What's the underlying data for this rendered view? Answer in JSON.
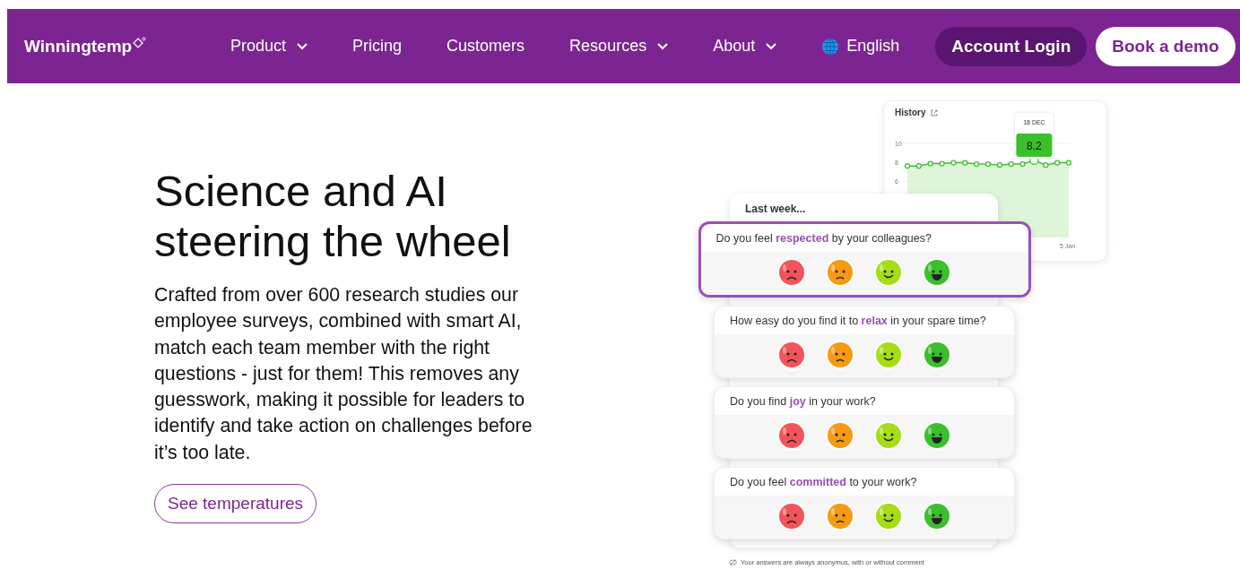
{
  "nav": {
    "logo": "Winningtemp",
    "items": [
      {
        "label": "Product",
        "dropdown": true
      },
      {
        "label": "Pricing",
        "dropdown": false
      },
      {
        "label": "Customers",
        "dropdown": false
      },
      {
        "label": "Resources",
        "dropdown": true
      },
      {
        "label": "About",
        "dropdown": true
      }
    ],
    "language": "English",
    "login": "Account Login",
    "demo": "Book a demo"
  },
  "hero": {
    "title": "Science and AI steering the wheel",
    "body": "Crafted from over 600 research studies our employee surveys, combined with smart AI, match each team member with the right questions - just for them! This removes any guesswork, making it possible for leaders to identify and take action on challenges before it’s too late.",
    "cta": "See temperatures"
  },
  "history": {
    "title": "History",
    "y_labels": [
      "10",
      "8",
      "6"
    ],
    "tooltip": {
      "date": "18 DEC",
      "value": "8.2"
    },
    "end_label": "5 Jan"
  },
  "survey": {
    "header": "Last week...",
    "questions": [
      {
        "text": "Do you feel **respected** by your colleagues?",
        "highlighted": true,
        "options": [
          {
            "kind": "very_sad"
          },
          {
            "kind": "sad"
          },
          {
            "kind": "happy"
          },
          {
            "kind": "very_happy"
          }
        ]
      },
      {
        "text": "How easy do you find it to **relax** in your spare time?",
        "highlighted": false,
        "options": [
          {
            "kind": "very_sad"
          },
          {
            "kind": "sad"
          },
          {
            "kind": "happy"
          },
          {
            "kind": "very_happy"
          }
        ]
      },
      {
        "text": "Do you find **joy** in your work?",
        "highlighted": false,
        "options": [
          {
            "kind": "very_sad"
          },
          {
            "kind": "sad"
          },
          {
            "kind": "happy"
          },
          {
            "kind": "very_happy"
          }
        ]
      },
      {
        "text": "Do you feel **committed** to your work?",
        "highlighted": false,
        "options": [
          {
            "kind": "very_sad"
          },
          {
            "kind": "sad"
          },
          {
            "kind": "happy"
          },
          {
            "kind": "very_happy"
          }
        ]
      }
    ],
    "note": "Your answers are always anonymus, with or without comment"
  }
}
